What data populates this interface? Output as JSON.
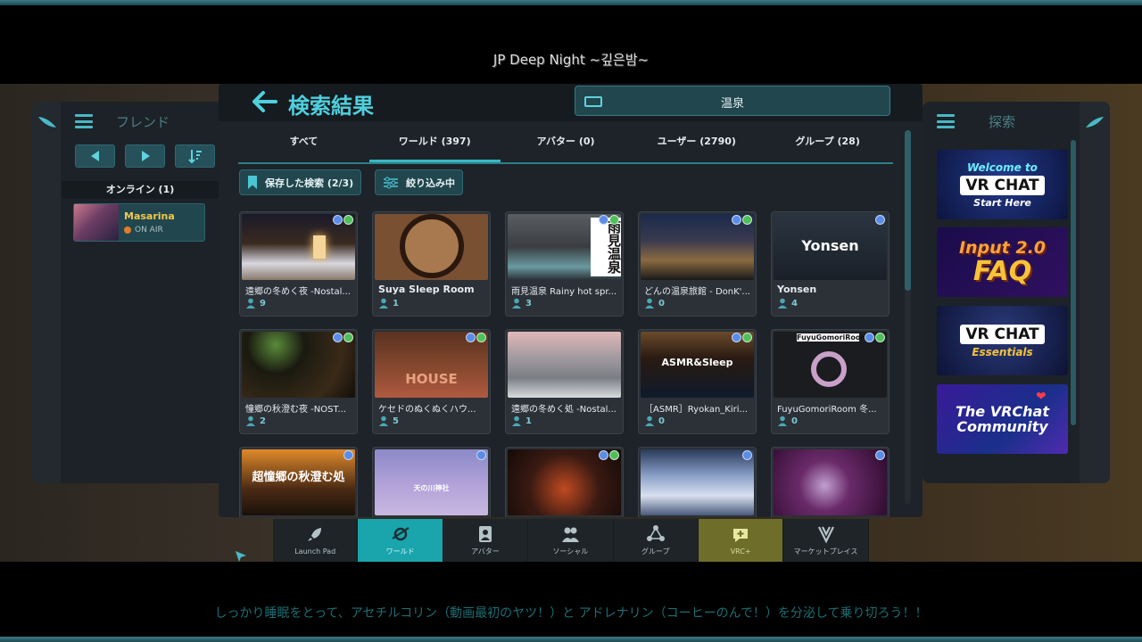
{
  "stream_title": "JP Deep Night ~깊은밤~",
  "subtitle": "しっかり睡眠をとって、アセチルコリン（動画最初のヤツ！）と アドレナリン（コーヒーのんで！）を分泌して乗り切ろう！！",
  "friends": {
    "title": "フレンド",
    "online_label": "オンライン (1)",
    "items": [
      {
        "name": "Masarina",
        "status": "ON AIR"
      }
    ]
  },
  "explore": {
    "title": "探索",
    "ads": [
      {
        "line1": "Welcome to",
        "logo": "VR CHAT",
        "line2": "Start Here"
      },
      {
        "line1": "Input 2.0",
        "line2": "FAQ"
      },
      {
        "logo": "VR CHAT",
        "line2": "Essentials"
      },
      {
        "line1": "The VRChat",
        "line2": "Community"
      }
    ]
  },
  "main": {
    "title": "検索結果",
    "search_value": "温泉",
    "tabs": [
      {
        "label": "すべて",
        "active": false
      },
      {
        "label": "ワールド (397)",
        "active": true
      },
      {
        "label": "アバター (0)",
        "active": false
      },
      {
        "label": "ユーザー (2790)",
        "active": false
      },
      {
        "label": "グループ (28)",
        "active": false
      }
    ],
    "saved_search": "保存した検索 (2/3)",
    "narrowing": "絞り込み中",
    "worlds": [
      {
        "name": "遠郷の冬めく夜 -Nostal...",
        "count": "9",
        "thumb_text": ""
      },
      {
        "name": "Suya Sleep Room",
        "count": "1",
        "thumb_text": ""
      },
      {
        "name": "雨見温泉 Rainy hot spr...",
        "count": "3",
        "thumb_text": "雨見温泉"
      },
      {
        "name": "どんの温泉旅館 - DonK'...",
        "count": "0",
        "thumb_text": ""
      },
      {
        "name": "Yonsen",
        "count": "4",
        "thumb_text": "Yonsen"
      },
      {
        "name": "憧郷の秋澄む夜 -NOST...",
        "count": "2",
        "thumb_text": ""
      },
      {
        "name": "ケセドのぬくぬくハウ...",
        "count": "5",
        "thumb_text": "HOUSE"
      },
      {
        "name": "遠郷の冬めく処 -Nostal...",
        "count": "1",
        "thumb_text": ""
      },
      {
        "name": "［ASMR］Ryokan_Kiri...",
        "count": "0",
        "thumb_text": "ASMR&Sleep"
      },
      {
        "name": "FuyuGomoriRoom 冬...",
        "count": "0",
        "thumb_text": "FuyuGomoriRoom"
      },
      {
        "name": "",
        "count": "",
        "thumb_text": "超憧郷の秋澄む処"
      },
      {
        "name": "",
        "count": "",
        "thumb_text": "天の川神社"
      },
      {
        "name": "",
        "count": "",
        "thumb_text": ""
      },
      {
        "name": "",
        "count": "",
        "thumb_text": ""
      },
      {
        "name": "",
        "count": "",
        "thumb_text": ""
      }
    ]
  },
  "dock": [
    {
      "label": "Launch Pad",
      "icon": "rocket-icon"
    },
    {
      "label": "ワールド",
      "icon": "planet-icon",
      "active": true
    },
    {
      "label": "アバター",
      "icon": "avatar-icon"
    },
    {
      "label": "ソーシャル",
      "icon": "social-icon"
    },
    {
      "label": "グループ",
      "icon": "group-icon"
    },
    {
      "label": "VRC+",
      "icon": "vrc-plus-icon"
    },
    {
      "label": "マーケットプレイス",
      "icon": "marketplace-icon"
    }
  ],
  "colors": {
    "accent": "#39b6c4",
    "panel": "#1d2328",
    "highlight_name": "#f2c84b"
  }
}
